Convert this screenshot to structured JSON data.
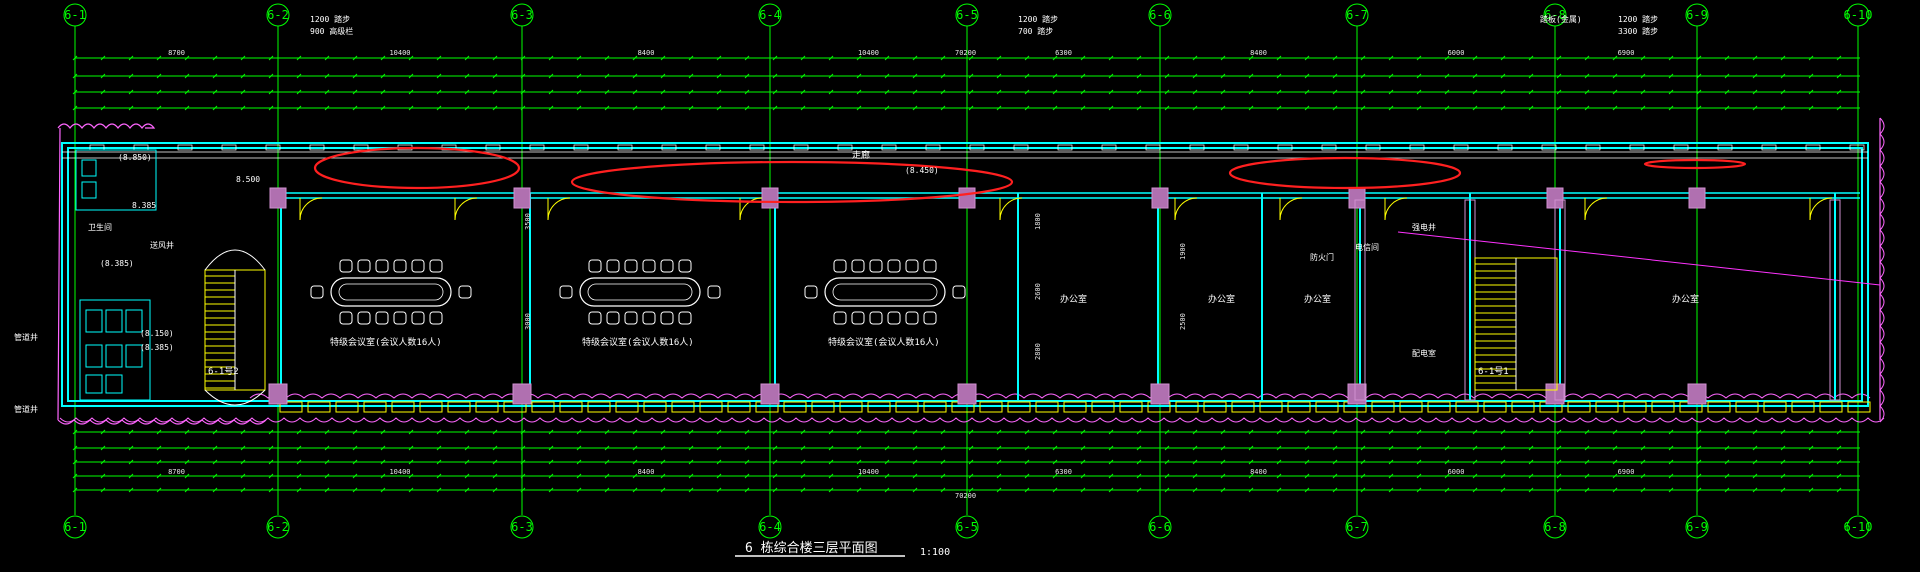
{
  "drawing": {
    "title": "6 栋综合楼三层平面图",
    "scale": "1:100"
  },
  "grid_axes": [
    "6-1",
    "6-2",
    "6-3",
    "6-4",
    "6-5",
    "6-6",
    "6-7",
    "6-8",
    "6-9",
    "6-10"
  ],
  "dimensions": {
    "top_span_row": [
      "8700",
      "10400",
      "8400",
      "10400",
      "6300",
      "8400",
      "6000",
      "6900"
    ],
    "total_length": "70200",
    "bottom_span_row": [
      "8700",
      "10400",
      "8400",
      "10400",
      "6300",
      "8400",
      "6000",
      "6900"
    ]
  },
  "labels_top": {
    "stair_top_a": "1200 踏步",
    "stair_top_b": "900 高级栏",
    "level_a": "1200 踏步",
    "level_b": "700 踏步",
    "right_a": "踏板(金属)",
    "right_b": "1200 踏步",
    "right_c": "3300 踏步"
  },
  "rooms": {
    "meeting_1": "特级会议室(会议人数16人)",
    "meeting_2": "特级会议室(会议人数16人)",
    "meeting_3": "特级会议室(会议人数16人)",
    "office_1": "办公室",
    "office_2": "办公室",
    "office_3": "办公室",
    "office_right": "办公室",
    "corridor": "走廊",
    "stair_left": "6-1号2",
    "stair_right": "6-1号1"
  },
  "elevations": {
    "e1": "(8.850)",
    "e2": "8.385",
    "e3": "(8.385)",
    "e4": "(8.150)",
    "e5": "(8.385)",
    "e6": "8.500",
    "e7": "(8.450)"
  },
  "annotations": {
    "toilet": "卫生间",
    "shaft_a": "管道井",
    "shaft_b": "管道井",
    "equip": "送风井",
    "fire_door": "防火门",
    "electric": "电信间",
    "cable": "强电井",
    "room_small": "配电室"
  },
  "colors": {
    "background": "#000000",
    "grid_line": "#00ff00",
    "wall": "#00ffff",
    "column": "#c080c0",
    "revision_cloud": "#ff66ff",
    "red_markup": "#ff2020",
    "window": "#ffff00",
    "text": "#ffffff"
  }
}
